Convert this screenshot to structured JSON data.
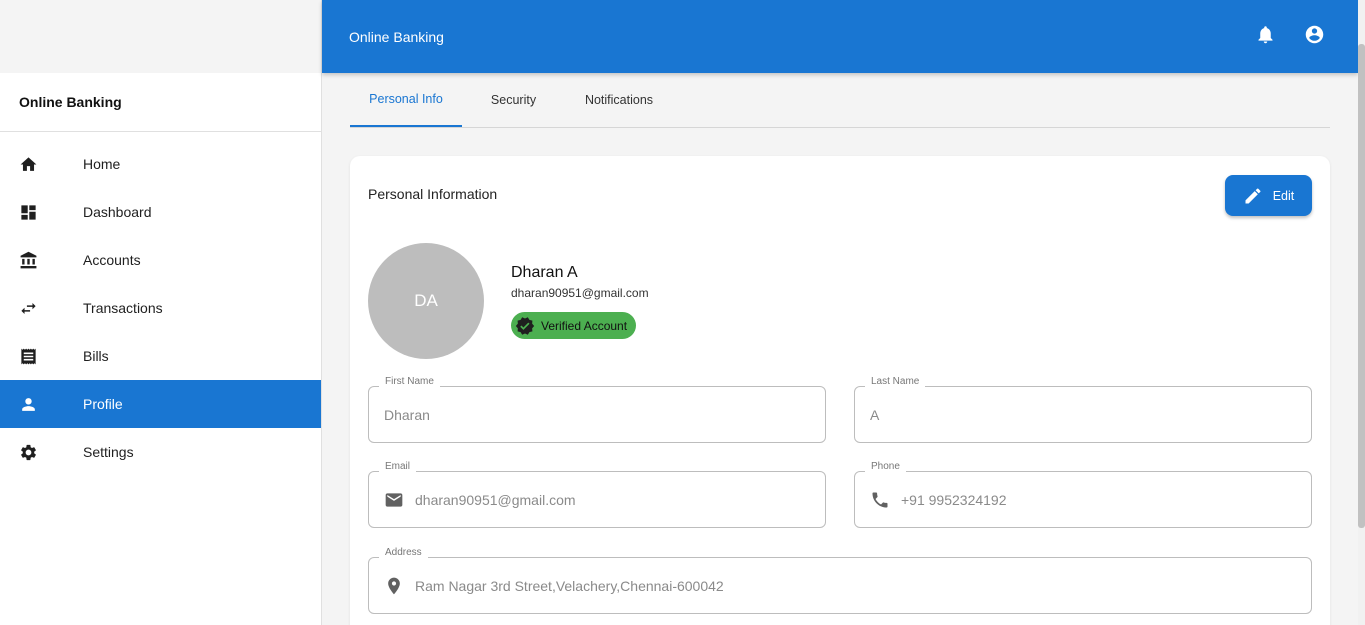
{
  "sidebar": {
    "title": "Online Banking",
    "items": [
      {
        "label": "Home",
        "icon": "home-icon"
      },
      {
        "label": "Dashboard",
        "icon": "dashboard-icon"
      },
      {
        "label": "Accounts",
        "icon": "bank-icon"
      },
      {
        "label": "Transactions",
        "icon": "swap-icon"
      },
      {
        "label": "Bills",
        "icon": "receipt-icon"
      },
      {
        "label": "Profile",
        "icon": "person-icon",
        "active": true
      },
      {
        "label": "Settings",
        "icon": "gear-icon"
      }
    ]
  },
  "header": {
    "title": "Online Banking",
    "icons": [
      "bell-icon",
      "account-circle-icon"
    ]
  },
  "tabs": [
    {
      "label": "Personal Info",
      "active": true
    },
    {
      "label": "Security"
    },
    {
      "label": "Notifications"
    }
  ],
  "card": {
    "title": "Personal Information",
    "edit_label": "Edit"
  },
  "profile": {
    "initials": "DA",
    "name": "Dharan A",
    "email": "dharan90951@gmail.com",
    "badge": "Verified Account"
  },
  "fields": {
    "first_name": {
      "label": "First Name",
      "value": "Dharan"
    },
    "last_name": {
      "label": "Last Name",
      "value": "A"
    },
    "email": {
      "label": "Email",
      "value": "dharan90951@gmail.com"
    },
    "phone": {
      "label": "Phone",
      "value": "+91 9952324192"
    },
    "address": {
      "label": "Address",
      "value": "Ram Nagar 3rd Street,Velachery,Chennai-600042"
    }
  },
  "colors": {
    "primary": "#1976d2",
    "verified": "#4caf50",
    "avatar": "#bdbdbd"
  }
}
